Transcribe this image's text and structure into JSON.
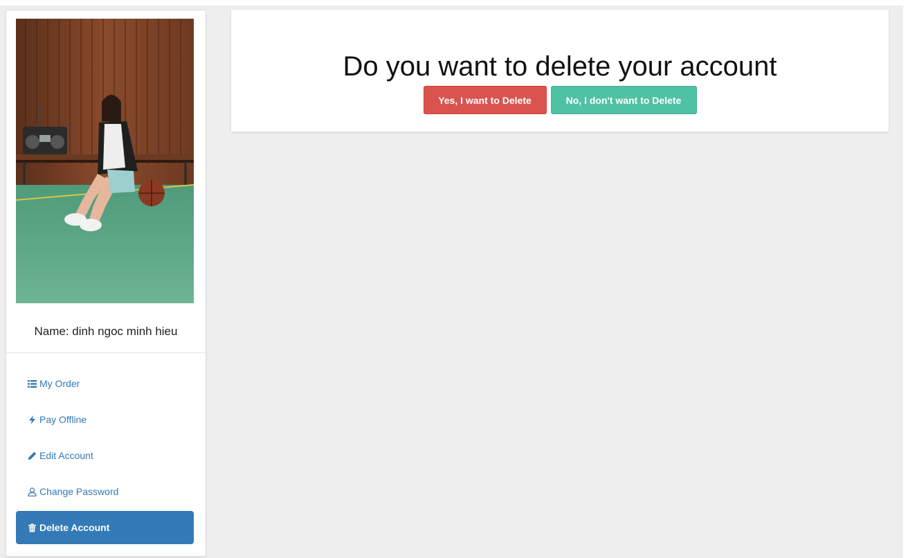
{
  "profile": {
    "name_text": "Name: dinh ngoc minh hieu",
    "photo_alt": "profile photo"
  },
  "menu": {
    "items": [
      {
        "label": "My Order",
        "icon": "list-icon",
        "active": false
      },
      {
        "label": "Pay Offline",
        "icon": "bolt-icon",
        "active": false
      },
      {
        "label": "Edit Account",
        "icon": "pencil-icon",
        "active": false
      },
      {
        "label": "Change Password",
        "icon": "user-icon",
        "active": false
      },
      {
        "label": "Delete Account",
        "icon": "trash-icon",
        "active": true
      }
    ]
  },
  "panel": {
    "title": "Do you want to delete your account",
    "confirm_label": "Yes, I want to Delete",
    "cancel_label": "No, I don't want to Delete"
  },
  "colors": {
    "page_background": "#eeeeee",
    "link": "#337ab7",
    "active_item": "#337ab7",
    "danger_button": "#d9534f",
    "cancel_button": "#4fc1a5"
  }
}
